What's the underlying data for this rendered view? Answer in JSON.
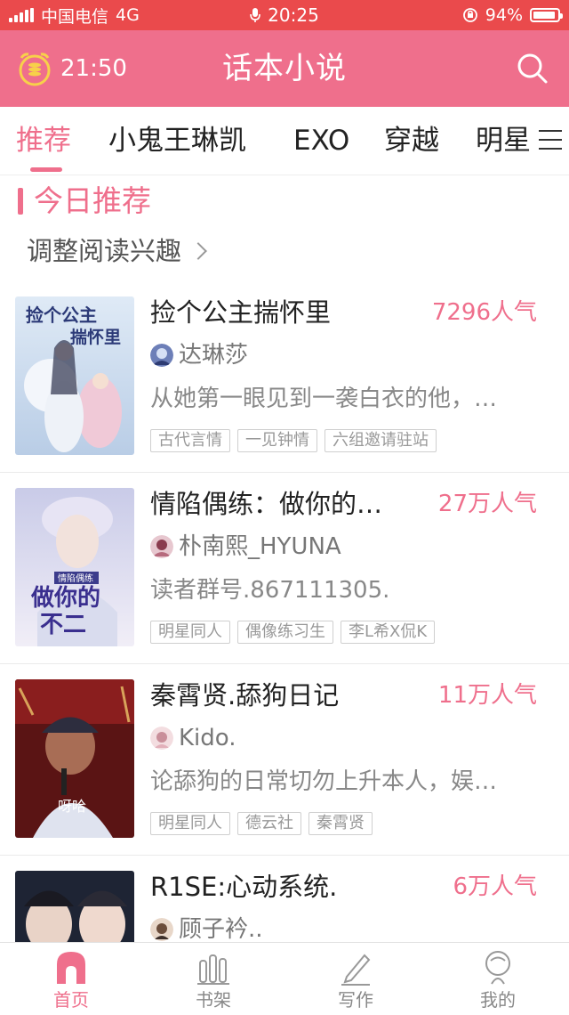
{
  "status_bar": {
    "carrier": "中国电信",
    "network": "4G",
    "time": "20:25",
    "battery": "94%",
    "battery_level": 0.94
  },
  "header": {
    "time": "21:50",
    "title": "话本小说"
  },
  "tabs": [
    {
      "label": "推荐",
      "active": true
    },
    {
      "label": "小鬼王琳凯"
    },
    {
      "label": "EXO"
    },
    {
      "label": "穿越"
    },
    {
      "label": "明星"
    }
  ],
  "section": {
    "title": "今日推荐",
    "adjust": "调整阅读兴趣"
  },
  "books": [
    {
      "title": "捡个公主揣怀里",
      "popularity": "7296人气",
      "author": "达琳莎",
      "desc": "从她第一眼见到一袭白衣的他，…",
      "tags": [
        "古代言情",
        "一见钟情",
        "六组邀请驻站"
      ],
      "cover_text": [
        "捡个公主",
        "揣怀里"
      ]
    },
    {
      "title": "情陷偶练：做你的…",
      "popularity": "27万人气",
      "author": "朴南熙_HYUNA",
      "desc": "读者群号.867111305.",
      "tags": [
        "明星同人",
        "偶像练习生",
        "李L希X侃K"
      ],
      "cover_text": [
        "情陷偶练",
        "做你的",
        "不二"
      ]
    },
    {
      "title": "秦霄贤.舔狗日记",
      "popularity": "11万人气",
      "author": "Kido.",
      "desc": "论舔狗的日常切勿上升本人，娱…",
      "tags": [
        "明星同人",
        "德云社",
        "秦霄贤"
      ],
      "cover_text": [
        "呀哈"
      ]
    },
    {
      "title": "R1SE:心动系统.",
      "popularity": "6万人气",
      "author": "顾子衿..",
      "desc": "",
      "tags": [],
      "cover_text": []
    }
  ],
  "bottom_nav": [
    {
      "label": "首页",
      "icon": "home-icon",
      "active": true
    },
    {
      "label": "书架",
      "icon": "bookshelf-icon"
    },
    {
      "label": "写作",
      "icon": "pen-icon"
    },
    {
      "label": "我的",
      "icon": "profile-icon"
    }
  ],
  "colors": {
    "status_bar": "#ea4a4c",
    "header": "#ef6f8c",
    "accent": "#ef6f8c"
  }
}
